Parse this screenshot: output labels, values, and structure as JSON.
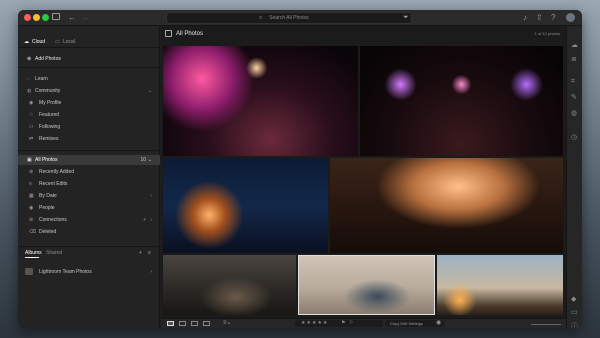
{
  "titlebar": {
    "search_placeholder": "Search All Photos"
  },
  "sidebar": {
    "tabs": {
      "cloud": "Cloud",
      "local": "Local"
    },
    "add_photos": "Add Photos",
    "learn": "Learn",
    "community": "Community",
    "community_items": [
      "My Profile",
      "Featured",
      "Following",
      "Remixes"
    ],
    "all_photos": "All Photos",
    "all_photos_count": "10",
    "library_items": [
      "Recently Added",
      "Recent Edits",
      "By Date",
      "People",
      "Connections",
      "Deleted"
    ],
    "albums_tab": "Albums",
    "shared_tab": "Shared",
    "album": "Lightroom Team Photos"
  },
  "main": {
    "title": "All Photos",
    "count": "1 of 10 photos"
  },
  "bottombar": {
    "copy_edit": "Copy Edit Settings"
  }
}
